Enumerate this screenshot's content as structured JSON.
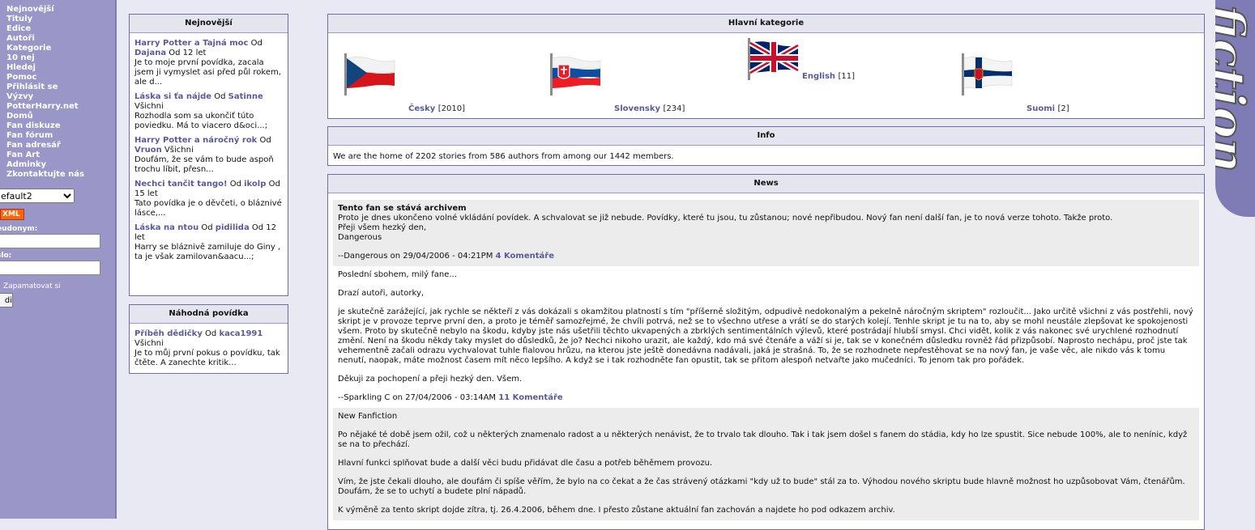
{
  "nav": {
    "items": [
      "Nejnovější",
      "Tituly",
      "Edice",
      "Autoři",
      "Kategorie",
      "10 nej",
      "Hledej",
      "Pomoc",
      "Přihlásit se",
      "Výzvy",
      "PotterHarry.net",
      "Domů",
      "Fan diskuze",
      "Fan fórum",
      "Fan adresář",
      "Fan Art",
      "Adminky",
      "Zkontaktujte nás"
    ],
    "skin_value": "efault2",
    "xml_label": "XML",
    "pseudonym_label": "eudonym:",
    "password_label": "slo:",
    "remember_label": "Zapamatovat si",
    "submit_label": "di"
  },
  "newest": {
    "title": "Nejnovější",
    "stories": [
      {
        "title": "Harry Potter a Tajná moc",
        "by": " Od ",
        "author": "Dajana",
        "meta": " Od 12 let",
        "summary": "Je to moje první povídka, zacala jsem ji vymyslet asi před půl rokem, ale d..."
      },
      {
        "title": "Láska si ťa nájde",
        "by": " Od ",
        "author": "Satinne",
        "meta": " Všichni",
        "summary": "Rozhodla som sa ukončiť túto poviedku. Má to viacero d&oci...;"
      },
      {
        "title": "Harry Potter a náročný rok",
        "by": " Od ",
        "author": "Vruon",
        "meta": " Všichni",
        "summary": "Doufám, že se vám to bude aspoň trochu líbit, přesn..."
      },
      {
        "title": "Nechci tančit tango!",
        "by": " Od ",
        "author": "ikolp",
        "meta": " Od 15 let",
        "summary": "Tato povídka je o děvčeti, o bláznivé lásce,..."
      },
      {
        "title": "Láska na ntou",
        "by": " Od ",
        "author": "pidilida",
        "meta": " Od 12 let",
        "summary": " Harry se bláznivě zamiluje do Giny , ta je však zamilovan&aacu...;"
      }
    ]
  },
  "random": {
    "title": "Náhodná povídka",
    "story": {
      "title": "Příběh dědičky",
      "by": " Od ",
      "author": "kaca1991",
      "meta": " Všichni",
      "summary": "Je to můj první pokus o povídku, tak čtěte. A zanechte kritik..."
    }
  },
  "categories": {
    "title": "Hlavní kategorie",
    "items": [
      {
        "name": "Česky",
        "count": "[2010]"
      },
      {
        "name": "Slovensky",
        "count": "[234]"
      },
      {
        "name": "English",
        "count": "[11]"
      },
      {
        "name": "Suomi",
        "count": "[2]"
      }
    ]
  },
  "info": {
    "title": "Info",
    "text": "We are the home of 2202 stories from 586 authors from among our 1442 members."
  },
  "news": {
    "title": "News",
    "items": [
      {
        "headline": "Tento fan se stává archivem",
        "body": "Proto je dnes ukončeno volné vkládání povídek. A schvalovat se již nebude. Povídky, které tu jsou, tu zůstanou; nové nepřibudou. Nový fan není další fan, je to nová verze tohoto. Takže proto.\nPřeji všem hezký den,\nDangerous",
        "footer": "--Dangerous on 29/04/2006 - 04:21PM",
        "comments": "4 Komentáře"
      },
      {
        "p1": "Poslední sbohem, milý fane...",
        "p2": "Drazí autoři, autorky,",
        "p3": "je skutečně zarážející, jak rychle se někteří z vás dokázali s okamžitou platností s tím \"příšerně složitým, odpudivě nedokonalým a pekelně náročným skriptem\" rozloučit... Jako určitě všichni z vás postřehli, nový skript je v provoze teprve první den, a proto je téměř samozřejmé, že chvíli potrvá, než se to všechno utřese a vrátí se do starých kolejí. Tenhle skript je tu na to, aby se mohl neustále zlepšovat ke spokojenosti všem. Proto by skutečně nebylo na škodu, kdyby jste nás ušetřili těchto ukvapených a zbrklých sentimentálních výlevů, které postrádají hlubší smysl. Chci vidět, kolik z vás nakonec své urychlené rozhodnutí změní. Není na škodu někdy taky myslet do důsledků, že jo? Nechci nikoho urazit, ale každý, kdo má své čtenáře a váží si je, tak se v konečném důsledku rovněž řád přizpůsobí. Naprosto nechápu, proč jste tak vehementně začali odrazu vychvalovat tuhle fialovou hrůzu, na kterou jste ještě donedávna nadávali, jaká je strašná. To, že se rozhodnete nepřestěhovat se na nový fan, je vaše věc, ale nikdo vás k tomu nenutí, naopak, máte možnost časem mít něco lepšího. A když se i tak rozhodněte fan opustit, tak se přitom alespoň netvařte jako mučedníci. To jenom tak pro pořádek.",
        "p4": "Děkuji za pochopení a přeji hezký den. Všem.",
        "footer": "--Sparkling C on 27/04/2006 - 03:14AM",
        "comments": "11 Komentáře"
      },
      {
        "p1": "New Fanfiction",
        "p2": "Po nějaké té době jsem ožil, což u některých znamenalo radost a u některých nenávist, že to trvalo tak dlouho. Tak i tak jsem došel s fanem do stádia, kdy ho lze spustit. Sice nebude 100%, ale to nenínic, když se na to přechází.",
        "p3": "Hlavní funkci splňovat bude a další věci budu přidávat dle času a potřeb běhěmem provozu.",
        "p4": "Vím, že jste čekali dlouho, ale doufám či spíše věřím, že bylo na co čekat a že čas strávený otázkami \"kdy už to bude\" stál za to. Výhodou nového skriptu bude hlavně možnost ho uzpůsobovat Vám, čtenářům. Doufám, že se to uchytí a budete plní nápadů.",
        "p5": "K výměně za tento skript dojde zítra, tj. 26.4.2006, během dne. I přesto zůstane aktuální fan zachován a najdete ho pod odkazem archiv."
      }
    ]
  },
  "banner": {
    "text": "fiction"
  },
  "colors": {
    "nav_bg": "#9a97c8",
    "link": "#5a5a9a",
    "border": "#6f6ca8",
    "title_bg": "#e5e5ef",
    "xml_orange": "#ff6600"
  },
  "icons": [
    "flag-czech-icon",
    "flag-slovak-icon",
    "flag-uk-icon",
    "flag-finland-icon"
  ]
}
